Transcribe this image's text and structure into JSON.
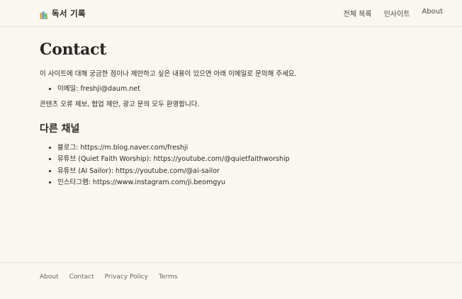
{
  "header": {
    "brand_icon": "books-icon",
    "brand_title": "독서 기록",
    "nav": [
      {
        "label": "전체 목록"
      },
      {
        "label": "인사이트"
      },
      {
        "label": "About"
      }
    ]
  },
  "main": {
    "title": "Contact",
    "intro": "이 사이트에 대해 궁금한 점이나 제안하고 싶은 내용이 있으면 아래 이메일로 문의해 주세요.",
    "email_item": "이메일: freshji@daum.net",
    "note": "콘텐츠 오류 제보, 협업 제안, 광고 문의 모두 환영합니다.",
    "channels_title": "다른 채널",
    "channels": [
      {
        "text": "블로그: https://m.blog.naver.com/freshji"
      },
      {
        "text": "유튜브 (Quiet Faith Worship): https://youtube.com/@quietfaithworship"
      },
      {
        "text": "유튜브 (AI Sailor): https://youtube.com/@ai-sailor"
      },
      {
        "text": "인스타그램: https://www.instagram.com/ji.beomgyu"
      }
    ]
  },
  "footer": {
    "links": [
      {
        "label": "About"
      },
      {
        "label": "Contact"
      },
      {
        "label": "Privacy Policy"
      },
      {
        "label": "Terms"
      }
    ]
  },
  "colors": {
    "background": "#faf7f2",
    "text": "#2a2622",
    "border": "#e6e1d8"
  }
}
